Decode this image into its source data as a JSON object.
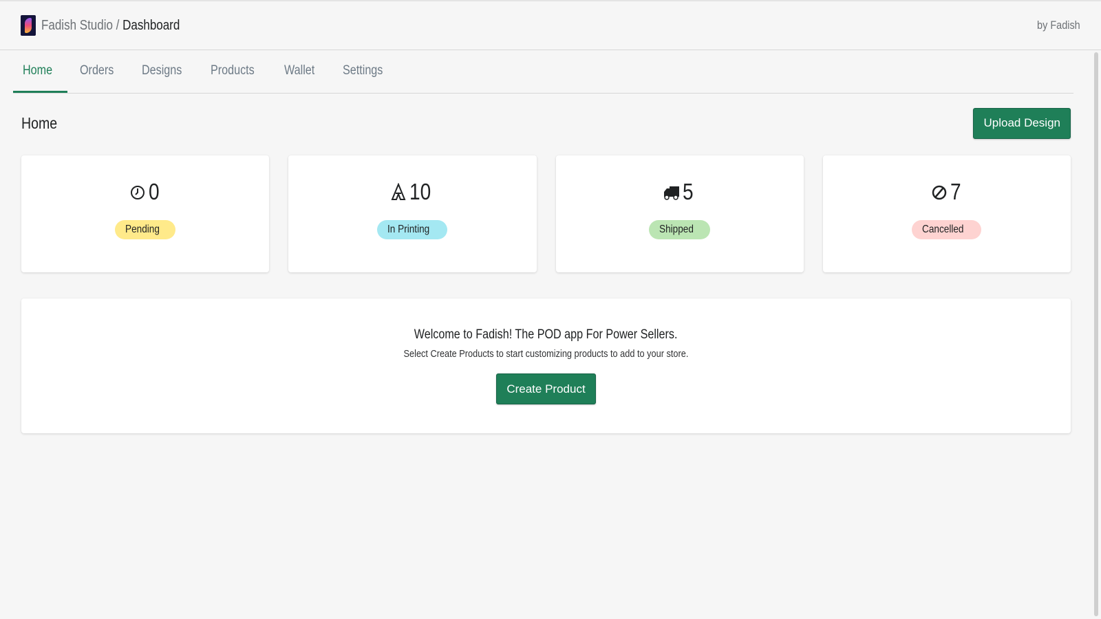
{
  "topbar": {
    "studio": "Fadish Studio",
    "separator": "/",
    "page": "Dashboard",
    "by": "by Fadish"
  },
  "tabs": [
    {
      "label": "Home"
    },
    {
      "label": "Orders"
    },
    {
      "label": "Designs"
    },
    {
      "label": "Products"
    },
    {
      "label": "Wallet"
    },
    {
      "label": "Settings"
    }
  ],
  "header": {
    "title": "Home",
    "upload_label": "Upload Design"
  },
  "stats": [
    {
      "icon": "clock-icon",
      "count": "0",
      "label": "Pending",
      "color": "#ffea8a"
    },
    {
      "icon": "printer-icon",
      "count": "10",
      "label": "In Printing",
      "color": "#a4e8f2"
    },
    {
      "icon": "truck-icon",
      "count": "5",
      "label": "Shipped",
      "color": "#bbe5b3"
    },
    {
      "icon": "cancel-icon",
      "count": "7",
      "label": "Cancelled",
      "color": "#fed3d1"
    }
  ],
  "welcome": {
    "title": "Welcome to Fadish! The POD app For Power Sellers.",
    "subtitle": "Select Create Products to start customizing products to add to your store.",
    "button": "Create Product"
  }
}
